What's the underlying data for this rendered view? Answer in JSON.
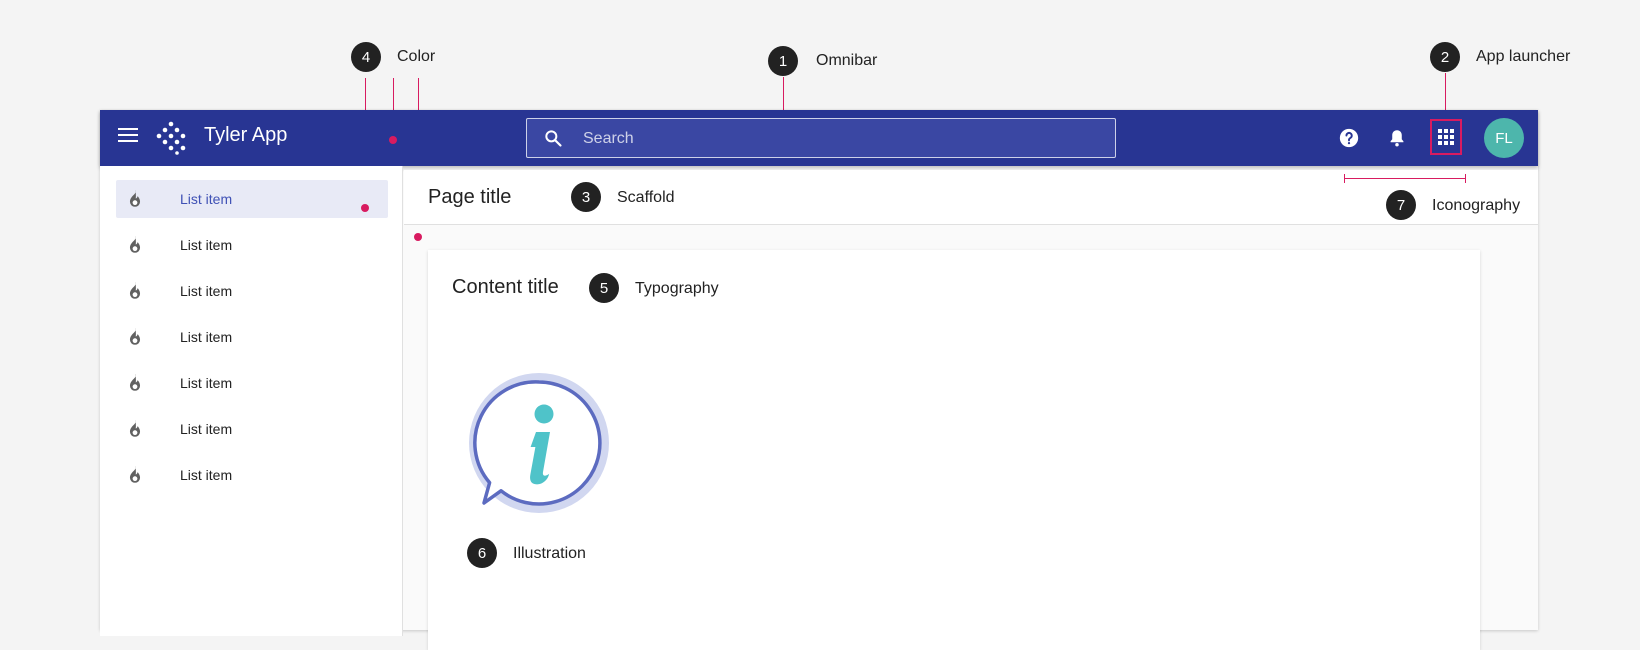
{
  "annotations": [
    {
      "number": "1",
      "label": "Omnibar"
    },
    {
      "number": "2",
      "label": "App launcher"
    },
    {
      "number": "3",
      "label": "Scaffold"
    },
    {
      "number": "4",
      "label": "Color"
    },
    {
      "number": "5",
      "label": "Typography"
    },
    {
      "number": "6",
      "label": "Illustration"
    },
    {
      "number": "7",
      "label": "Iconography"
    }
  ],
  "omnibar": {
    "title": "Tyler App",
    "search_placeholder": "Search",
    "avatar_initials": "FL",
    "background_color": "#283593"
  },
  "sidebar": {
    "items": [
      {
        "label": "List item",
        "icon": "flame-icon",
        "selected": true
      },
      {
        "label": "List item",
        "icon": "flame-icon",
        "selected": false
      },
      {
        "label": "List item",
        "icon": "flame-icon",
        "selected": false
      },
      {
        "label": "List item",
        "icon": "flame-icon",
        "selected": false
      },
      {
        "label": "List item",
        "icon": "flame-icon",
        "selected": false
      },
      {
        "label": "List item",
        "icon": "flame-icon",
        "selected": false
      },
      {
        "label": "List item",
        "icon": "flame-icon",
        "selected": false
      }
    ]
  },
  "page": {
    "title": "Page title",
    "content_title": "Content title"
  },
  "colors": {
    "accent": "#d81b60",
    "primary": "#283593",
    "avatar": "#4db6ac",
    "selected_item": "#e8eaf6"
  }
}
